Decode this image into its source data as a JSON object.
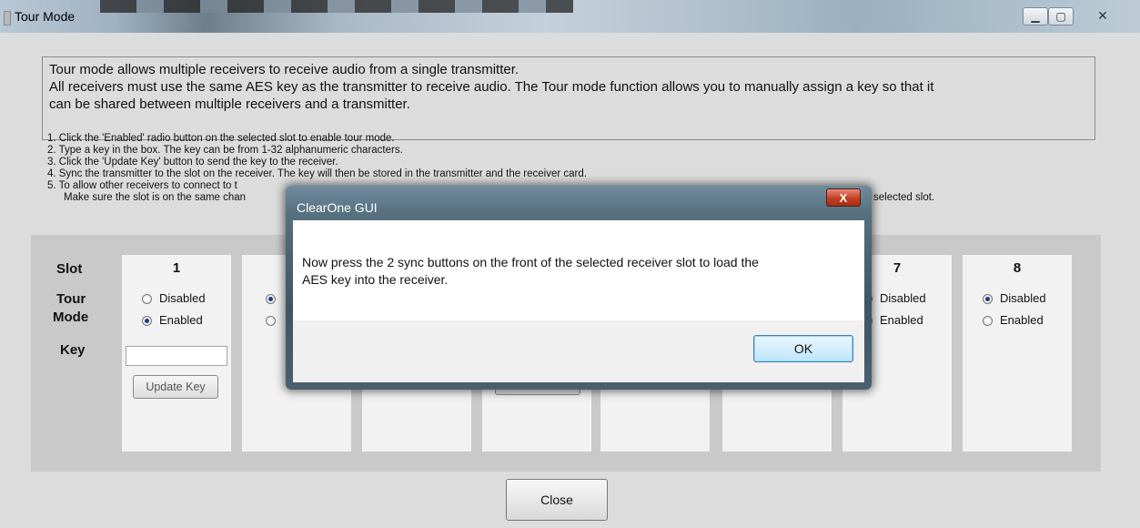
{
  "window": {
    "title": "Tour Mode",
    "minimize_glyph": "▁",
    "maximize_glyph": "▢",
    "close_glyph": "✕"
  },
  "info_box": {
    "lines": [
      "Tour mode allows multiple receivers to receive audio from a single transmitter.",
      "All receivers must use the same AES key as the transmitter to receive audio. The Tour mode function allows you to manually assign a key so that it",
      "can be shared between multiple receivers and a transmitter."
    ]
  },
  "steps": [
    "1. Click the 'Enabled' radio button on the selected slot to enable tour mode.",
    "2. Type a key in the box. The key can be from 1-32 alphanumeric characters.",
    "3. Click the 'Update Key' button to send the key to the receiver.",
    "4. Sync the transmitter to the slot on the receiver. The key will then be stored in the transmitter and the receiver card.",
    "5. To allow other receivers to connect to t",
    "Make sure the slot is on the same chan"
  ],
  "steps_tail": "selected slot.",
  "labels": {
    "slot": "Slot",
    "tour": "Tour",
    "mode": "Mode",
    "key": "Key"
  },
  "slots": [
    {
      "number": "1",
      "disabled_label": "Disabled",
      "enabled_label": "Enabled",
      "selected": "Enabled",
      "key_value": "",
      "update_label": "Update Key"
    },
    {
      "number": "7",
      "disabled_label": "Disabled",
      "enabled_label": "Enabled",
      "selected": "Disabled"
    },
    {
      "number": "8",
      "disabled_label": "Disabled",
      "enabled_label": "Enabled",
      "selected": "Disabled"
    }
  ],
  "partial_update_label": "Update Key",
  "close_button": "Close",
  "dialog": {
    "title": "ClearOne GUI",
    "close_glyph": "X",
    "message_lines": [
      "Now press the 2 sync buttons on the front of the selected receiver slot to load the",
      "AES key into the receiver."
    ],
    "ok_label": "OK"
  }
}
